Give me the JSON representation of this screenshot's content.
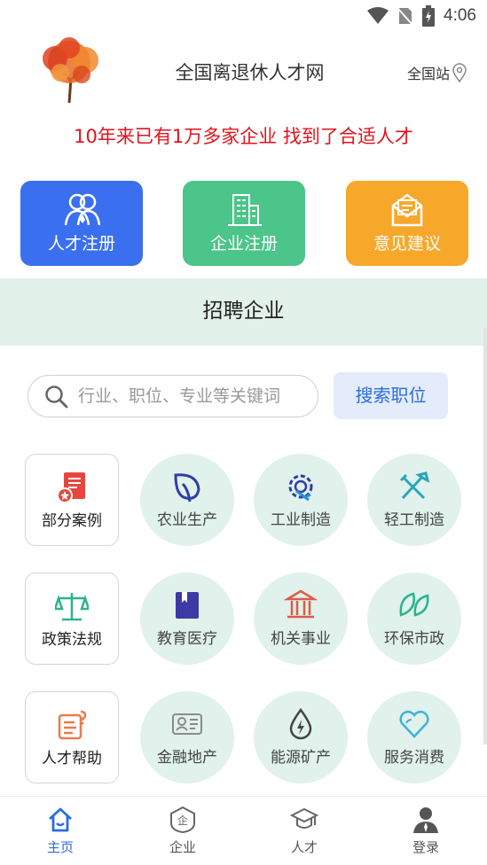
{
  "status": {
    "time": "4:06"
  },
  "header": {
    "title": "全国离退休人才网",
    "region": "全国站"
  },
  "tagline": "10年来已有1万多家企业 找到了合适人才",
  "quick_actions": [
    {
      "label": "人才注册",
      "icon": "talent-register-icon",
      "color": "#3a6ff0"
    },
    {
      "label": "企业注册",
      "icon": "building-icon",
      "color": "#4bc589"
    },
    {
      "label": "意见建议",
      "icon": "mail-icon",
      "color": "#f7a82a"
    }
  ],
  "section": {
    "title": "招聘企业"
  },
  "search": {
    "placeholder": "行业、职位、专业等关键词",
    "button": "搜索职位"
  },
  "grid": [
    {
      "label": "部分案例",
      "icon": "cases-book-icon"
    },
    {
      "label": "农业生产",
      "icon": "leaf-icon"
    },
    {
      "label": "工业制造",
      "icon": "gear-wrench-icon"
    },
    {
      "label": "轻工制造",
      "icon": "tools-icon"
    },
    {
      "label": "政策法规",
      "icon": "scales-icon"
    },
    {
      "label": "教育医疗",
      "icon": "book-icon"
    },
    {
      "label": "机关事业",
      "icon": "government-building-icon"
    },
    {
      "label": "环保市政",
      "icon": "eco-leaves-icon"
    },
    {
      "label": "人才帮助",
      "icon": "help-note-icon"
    },
    {
      "label": "金融地产",
      "icon": "id-card-icon"
    },
    {
      "label": "能源矿产",
      "icon": "energy-drop-icon"
    },
    {
      "label": "服务消费",
      "icon": "heart-icon"
    }
  ],
  "tabs": [
    {
      "label": "主页",
      "icon": "home-icon",
      "active": true
    },
    {
      "label": "企业",
      "icon": "enterprise-badge-icon"
    },
    {
      "label": "人才",
      "icon": "graduation-cap-icon"
    },
    {
      "label": "登录",
      "icon": "user-icon"
    }
  ],
  "colors": {
    "accent_blue": "#2a6de0",
    "tagline_red": "#e3121b",
    "band_green": "#e2f1e9"
  }
}
